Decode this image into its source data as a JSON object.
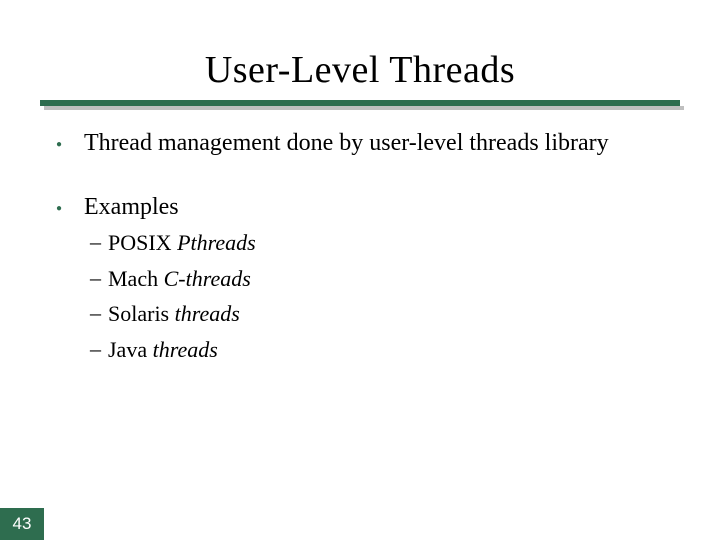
{
  "title": "User-Level Threads",
  "bullets": [
    {
      "text": "Thread management done by user-level threads library"
    },
    {
      "text": "Examples",
      "subs": [
        {
          "prefix": "POSIX ",
          "emph": "Pthreads"
        },
        {
          "prefix": "Mach ",
          "emph": "C-threads"
        },
        {
          "prefix": "Solaris ",
          "emph": "threads"
        },
        {
          "prefix": "Java ",
          "emph": "threads"
        }
      ]
    }
  ],
  "page_number": "43",
  "colors": {
    "accent": "#2e6d4f"
  }
}
